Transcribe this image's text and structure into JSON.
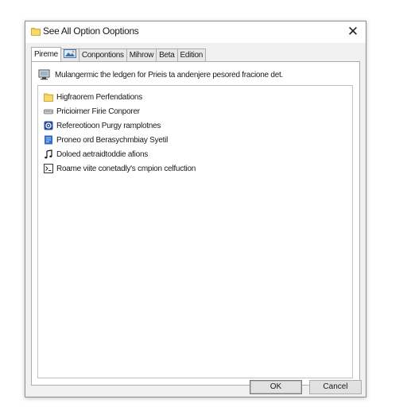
{
  "window": {
    "title": "See All Option Ooptions",
    "title_icon": "folder-icon",
    "close_glyph": "✕"
  },
  "tabs": [
    {
      "label": "Pireme",
      "active": true
    },
    {
      "label": "",
      "icon": "picture-icon"
    },
    {
      "label": "Conpontions"
    },
    {
      "label": "Mihrow"
    },
    {
      "label": "Beta"
    },
    {
      "label": "Edition"
    }
  ],
  "description": {
    "icon": "monitor-icon",
    "text": "Mulangermic the ledgen for Prieis ta andenjere pesored fracione det."
  },
  "list": [
    {
      "icon": "folder-icon",
      "label": "Higfraorem Perfendations"
    },
    {
      "icon": "drive-icon",
      "label": "Pricioimer Firie Conporer"
    },
    {
      "icon": "gear-network-icon",
      "label": "Refereotioon Purgy ramplotnes"
    },
    {
      "icon": "document-blue-icon",
      "label": "Proneo ord Berasychmbiay Syetil"
    },
    {
      "icon": "music-note-icon",
      "label": "Doloed aetraidtoddie afions"
    },
    {
      "icon": "terminal-icon",
      "label": "Roame viite conetadly's cmpion celfuction"
    }
  ],
  "buttons": {
    "ok_label": "OK",
    "cancel_label": "Cancel"
  },
  "colors": {
    "dialog_bg": "#f0f0f0",
    "border": "#adadad",
    "folder": "#f2c94c",
    "accent_blue": "#2f6fd0"
  }
}
